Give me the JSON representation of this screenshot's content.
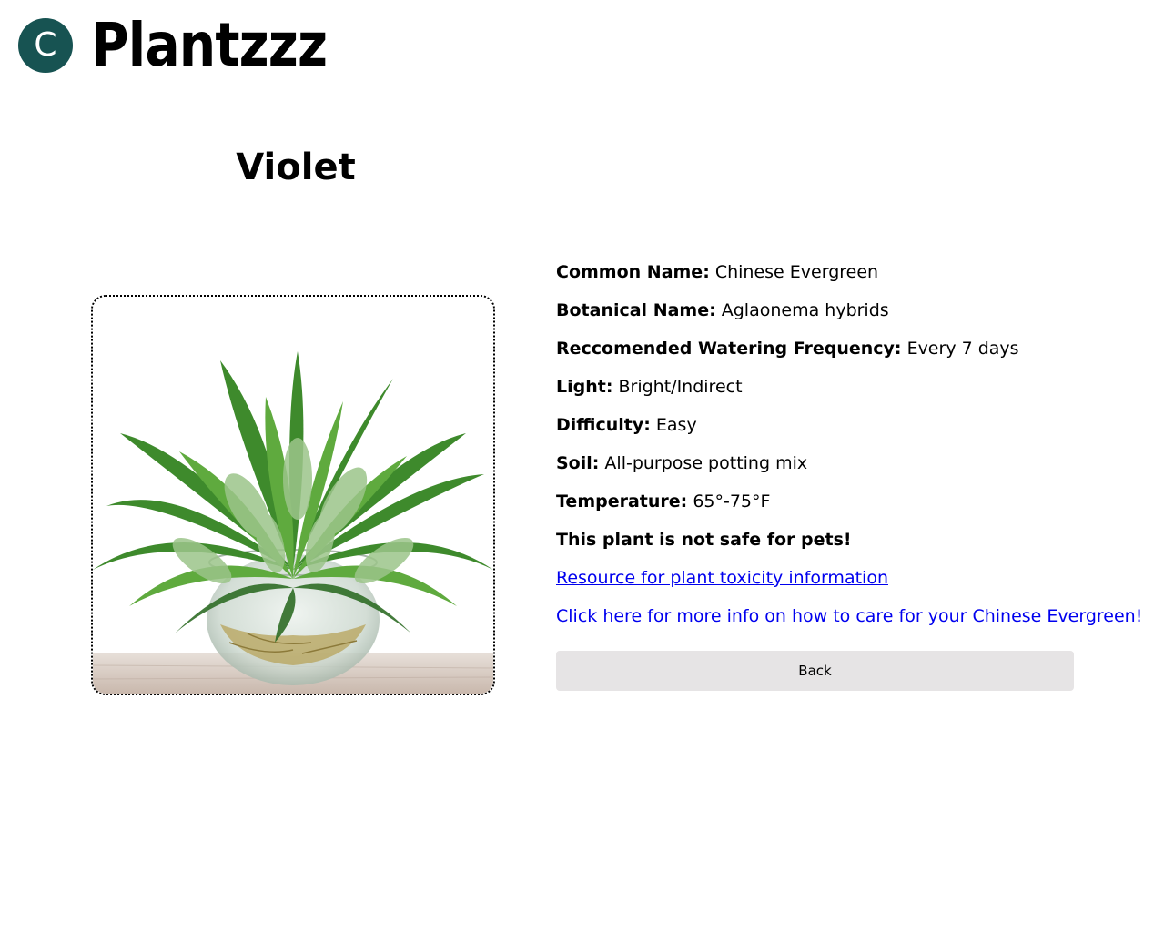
{
  "header": {
    "avatar_letter": "C",
    "brand": "Plantzzz"
  },
  "plant": {
    "title": "Violet",
    "image_icon": "plant-photo-icon",
    "fields": [
      {
        "label": "Common Name:",
        "value": "Chinese Evergreen"
      },
      {
        "label": "Botanical Name:",
        "value": "Aglaonema hybrids"
      },
      {
        "label": "Reccomended Watering Frequency:",
        "value": "Every 7 days"
      },
      {
        "label": "Light:",
        "value": "Bright/Indirect"
      },
      {
        "label": "Difficulty:",
        "value": "Easy"
      },
      {
        "label": "Soil:",
        "value": "All-purpose potting mix"
      },
      {
        "label": "Temperature:",
        "value": "65°-75°F"
      }
    ],
    "pet_warning": "This plant is not safe for pets!",
    "links": {
      "toxicity": "Resource for plant toxicity information",
      "care": "Click here for more info on how to care for your Chinese Evergreen!"
    },
    "back_label": "Back"
  },
  "colors": {
    "avatar_bg": "#175352",
    "link": "#0000ee",
    "button_bg": "#e6e4e5"
  }
}
